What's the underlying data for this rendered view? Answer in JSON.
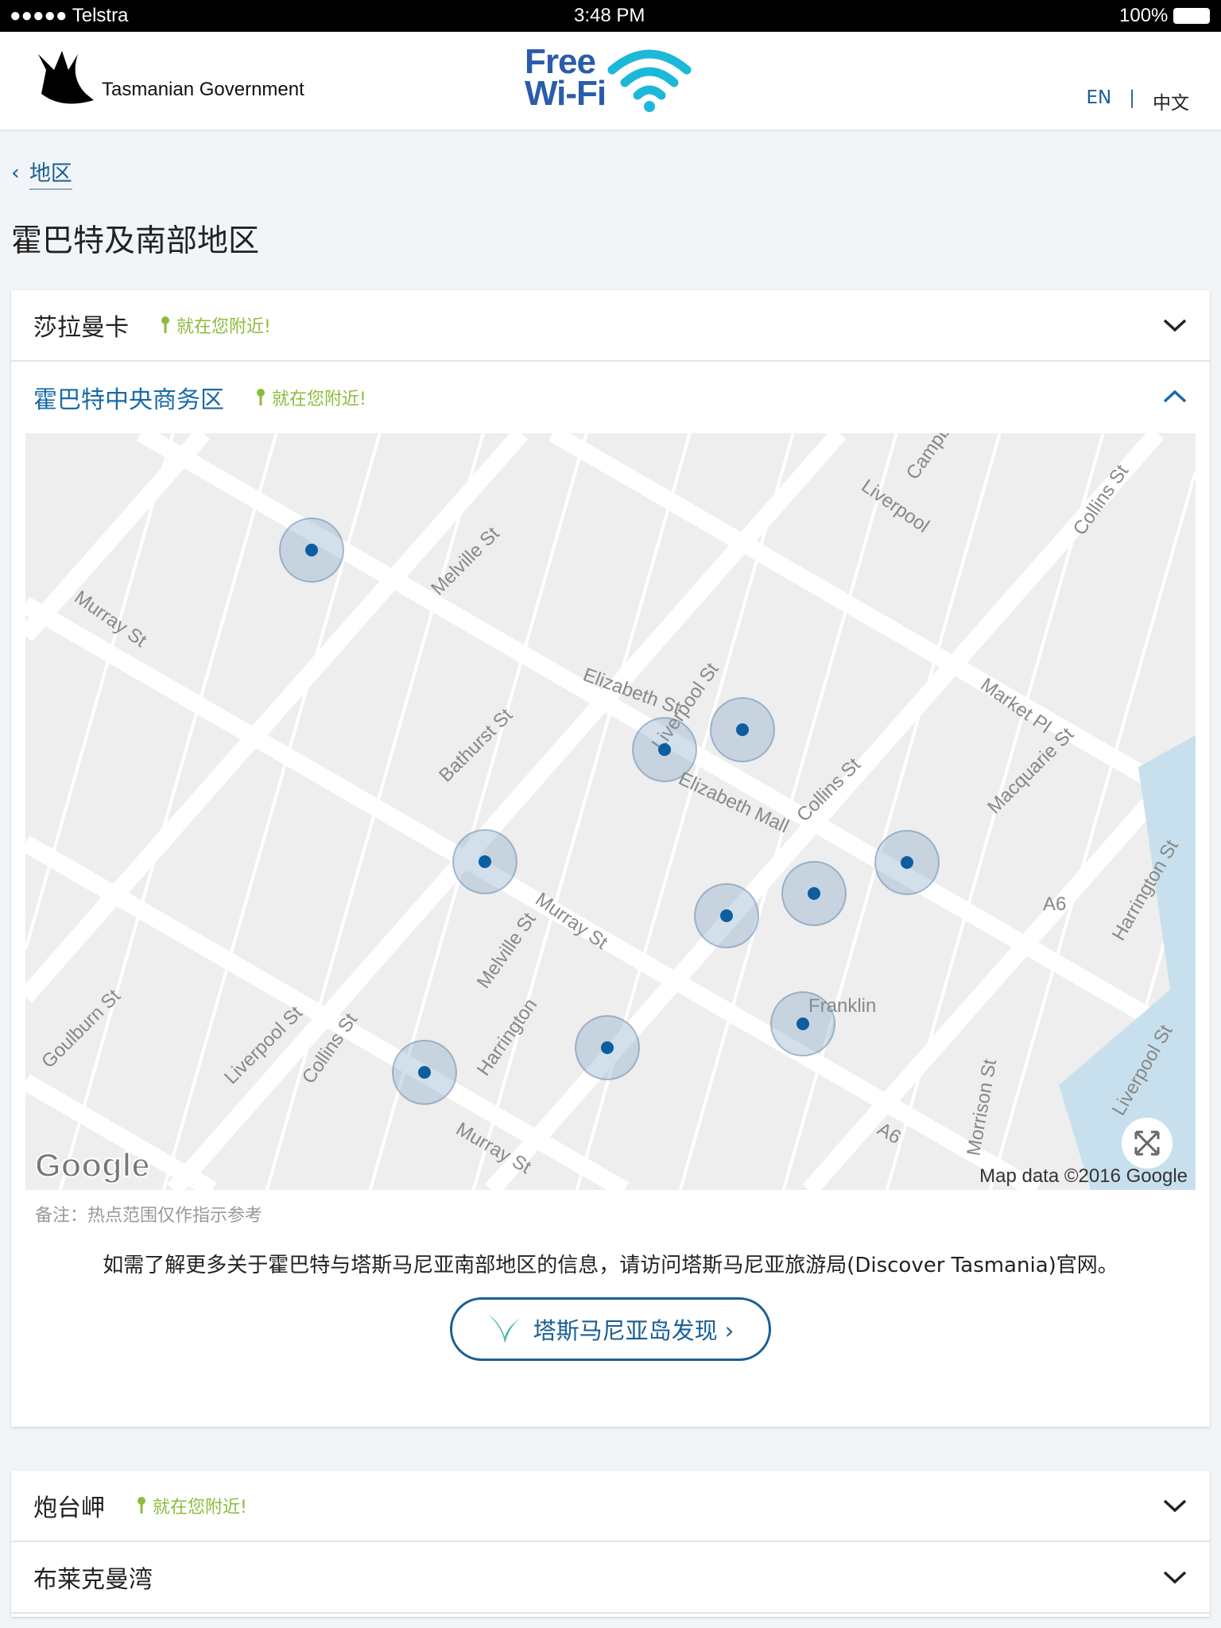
{
  "status_bar": {
    "carrier": "●●●●● Telstra",
    "time": "3:48 PM",
    "battery": "100%"
  },
  "header": {
    "gov_logo_text": "Tasmanian Government",
    "wifi_logo_line1": "Free",
    "wifi_logo_line2": "Wi-Fi",
    "lang_en": "EN",
    "lang_sep": "|",
    "lang_zh": "中文"
  },
  "breadcrumb": {
    "label": "地区"
  },
  "page_title": "霍巴特及南部地区",
  "accordion": [
    {
      "name": "莎拉曼卡",
      "near": "就在您附近!",
      "expanded": false
    },
    {
      "name": "霍巴特中央商务区",
      "near": "就在您附近!",
      "expanded": true
    },
    {
      "name": "炮台岬",
      "near": "就在您附近!",
      "expanded": false
    },
    {
      "name": "布莱克曼湾",
      "near": "",
      "expanded": false
    }
  ],
  "map": {
    "attribution": "Map data ©2016 Google",
    "google_logo": "Google",
    "streets": [
      "Murray St",
      "Melville St",
      "Campbell St",
      "Collins St",
      "Liverpool",
      "Market Pl",
      "Macquarie St",
      "Bathurst St",
      "Liverpool St",
      "Elizabeth Mall",
      "Collins St",
      "Murray St",
      "Melville St",
      "Goulburn St",
      "Liverpool St",
      "Collins St",
      "Harrington",
      "Murray St",
      "A6",
      "A6",
      "Franklin",
      "Harrington St",
      "Liverpool St",
      "Morrison St",
      "Elizabeth St"
    ]
  },
  "note": "备注：热点范围仅作指示参考",
  "info_text": "如需了解更多关于霍巴特与塔斯马尼亚南部地区的信息，请访问塔斯马尼亚旅游局(Discover Tasmania)官网。",
  "cta_button": "塔斯马尼亚岛发现 ›",
  "colors": {
    "accent": "#1a5f94",
    "near": "#8bbd3c",
    "hotspot": "#0d5ea0"
  }
}
